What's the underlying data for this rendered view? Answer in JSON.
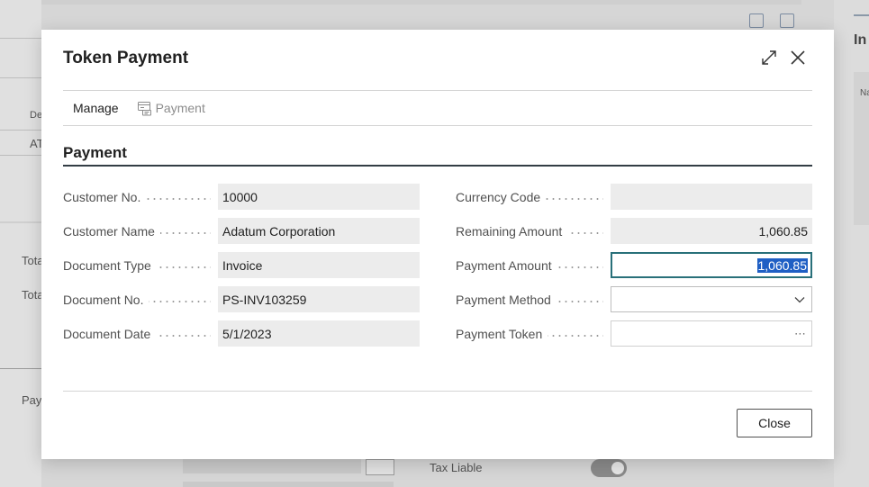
{
  "background": {
    "left_labels": [
      "De",
      "AT",
      "Tota",
      "Tota",
      "Pay"
    ],
    "right_header": "In",
    "right_sub": "Na",
    "tax_liable_label": "Tax Liable"
  },
  "dialog": {
    "title": "Token Payment",
    "actions": {
      "manage_label": "Manage",
      "payment_label": "Payment"
    },
    "section_title": "Payment",
    "left_fields": [
      {
        "label": "Customer No.",
        "value": "10000"
      },
      {
        "label": "Customer Name",
        "value": "Adatum Corporation"
      },
      {
        "label": "Document Type",
        "value": "Invoice"
      },
      {
        "label": "Document No.",
        "value": "PS-INV103259"
      },
      {
        "label": "Document Date",
        "value": "5/1/2023"
      }
    ],
    "right_fields": [
      {
        "label": "Currency Code",
        "value": ""
      },
      {
        "label": "Remaining Amount",
        "value": "1,060.85"
      },
      {
        "label": "Payment Amount",
        "value": "1,060.85"
      },
      {
        "label": "Payment Method",
        "value": ""
      },
      {
        "label": "Payment Token",
        "value": "⋯"
      }
    ],
    "close_label": "Close"
  },
  "icons": {
    "expand": "expand-icon",
    "close": "close-icon",
    "payment": "payment-icon",
    "dropdown": "chevron-down-icon",
    "share": "share-icon",
    "popout": "popout-icon"
  },
  "colors": {
    "active_field_border": "#29707a",
    "selection": "#1f5fc4",
    "section_rule": "#333d45"
  }
}
